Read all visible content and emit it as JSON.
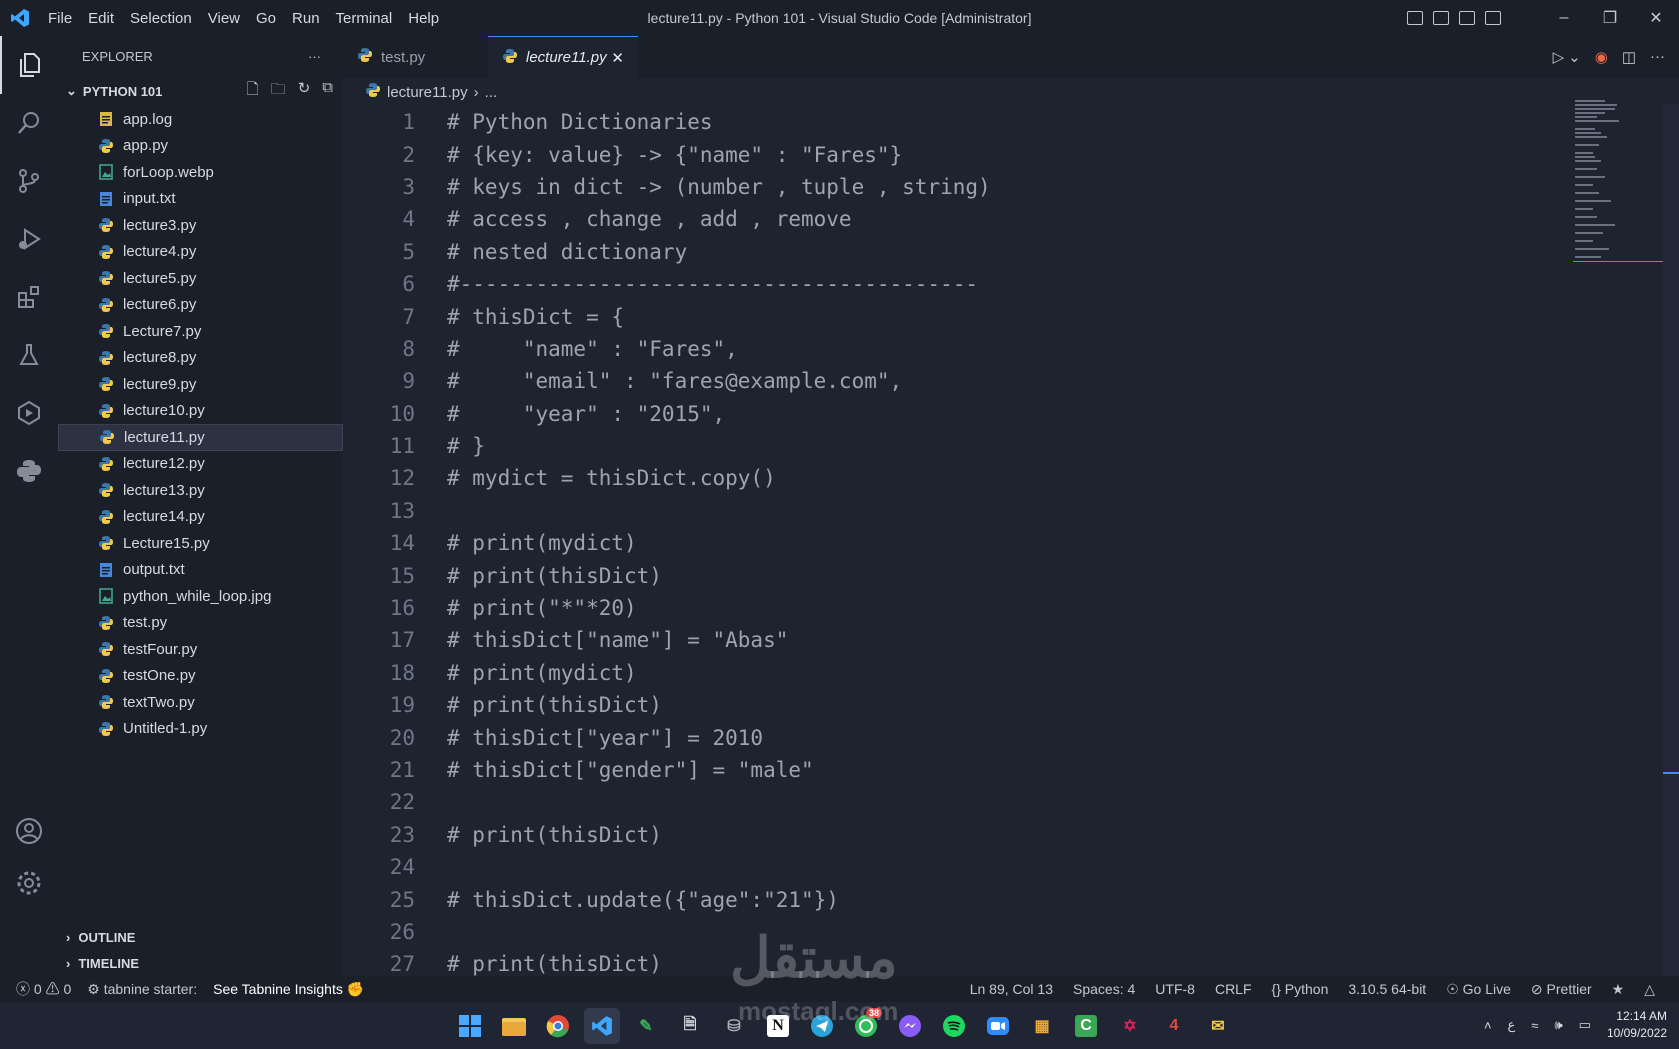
{
  "titlebar": {
    "menu": [
      "File",
      "Edit",
      "Selection",
      "View",
      "Go",
      "Run",
      "Terminal",
      "Help"
    ],
    "title": "lecture11.py - Python 101 - Visual Studio Code [Administrator]"
  },
  "sidebar": {
    "header": "EXPLORER",
    "project": "PYTHON 101",
    "files": [
      {
        "name": "app.log",
        "icon": "log-file-icon"
      },
      {
        "name": "app.py",
        "icon": "python-file-icon"
      },
      {
        "name": "forLoop.webp",
        "icon": "image-file-icon"
      },
      {
        "name": "input.txt",
        "icon": "text-file-icon"
      },
      {
        "name": "lecture3.py",
        "icon": "python-file-icon"
      },
      {
        "name": "lecture4.py",
        "icon": "python-file-icon"
      },
      {
        "name": "lecture5.py",
        "icon": "python-file-icon"
      },
      {
        "name": "lecture6.py",
        "icon": "python-file-icon"
      },
      {
        "name": "Lecture7.py",
        "icon": "python-file-icon"
      },
      {
        "name": "lecture8.py",
        "icon": "python-file-icon"
      },
      {
        "name": "lecture9.py",
        "icon": "python-file-icon"
      },
      {
        "name": "lecture10.py",
        "icon": "python-file-icon"
      },
      {
        "name": "lecture11.py",
        "icon": "python-file-icon",
        "selected": true
      },
      {
        "name": "lecture12.py",
        "icon": "python-file-icon"
      },
      {
        "name": "lecture13.py",
        "icon": "python-file-icon"
      },
      {
        "name": "lecture14.py",
        "icon": "python-file-icon"
      },
      {
        "name": "Lecture15.py",
        "icon": "python-file-icon"
      },
      {
        "name": "output.txt",
        "icon": "text-file-icon"
      },
      {
        "name": "python_while_loop.jpg",
        "icon": "image-file-icon"
      },
      {
        "name": "test.py",
        "icon": "python-file-icon"
      },
      {
        "name": "testFour.py",
        "icon": "python-file-icon"
      },
      {
        "name": "testOne.py",
        "icon": "python-file-icon"
      },
      {
        "name": "textTwo.py",
        "icon": "python-file-icon"
      },
      {
        "name": "Untitled-1.py",
        "icon": "python-file-icon"
      }
    ],
    "outline": "OUTLINE",
    "timeline": "TIMELINE"
  },
  "tabs": [
    {
      "label": "test.py",
      "active": false
    },
    {
      "label": "lecture11.py",
      "active": true
    }
  ],
  "breadcrumb": {
    "file": "lecture11.py",
    "rest": "..."
  },
  "editor": {
    "lines": [
      "# Python Dictionaries",
      "# {key: value} -> {\"name\" : \"Fares\"}",
      "# keys in dict -> (number , tuple , string)",
      "# access , change , add , remove",
      "# nested dictionary",
      "#-----------------------------------------",
      "# thisDict = {",
      "#     \"name\" : \"Fares\",",
      "#     \"email\" : \"fares@example.com\",",
      "#     \"year\" : \"2015\",",
      "# }",
      "# mydict = thisDict.copy()",
      "",
      "# print(mydict)",
      "# print(thisDict)",
      "# print(\"*\"*20)",
      "# thisDict[\"name\"] = \"Abas\"",
      "# print(mydict)",
      "# print(thisDict)",
      "# thisDict[\"year\"] = 2010",
      "# thisDict[\"gender\"] = \"male\"",
      "",
      "# print(thisDict)",
      "",
      "# thisDict.update({\"age\":\"21\"})",
      "",
      "# print(thisDict)"
    ]
  },
  "statusbar": {
    "errors": "0",
    "warnings": "0",
    "tabnine": "tabnine starter:",
    "insights": "See Tabnine Insights",
    "position": "Ln 89, Col 13",
    "spaces": "Spaces: 4",
    "encoding": "UTF-8",
    "eol": "CRLF",
    "language": "Python",
    "interpreter": "3.10.5 64-bit",
    "golive": "Go Live",
    "prettier": "Prettier"
  },
  "taskbar": {
    "whatsapp_badge": "38",
    "lang": "ع",
    "time": "12:14 AM",
    "date": "10/09/2022"
  },
  "watermark": {
    "arabic": "مستقل",
    "latin": "mostaql.com"
  },
  "colors": {
    "accent": "#4a86ff",
    "python_blue": "#3b77a8",
    "python_yellow": "#f2c94c"
  }
}
